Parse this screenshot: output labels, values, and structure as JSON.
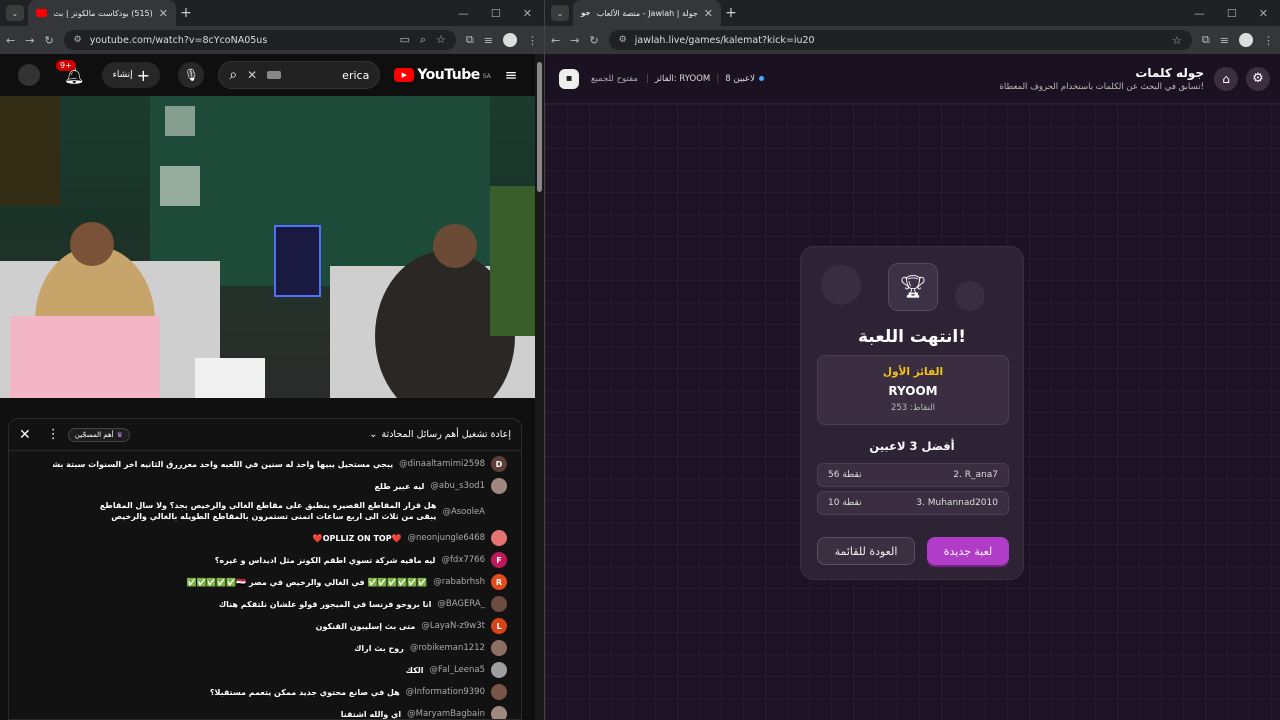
{
  "left": {
    "tab": {
      "title": "(515) بودكاست مالكونز | بث",
      "badge_color": "#ff0000"
    },
    "address": "youtube.com/watch?v=8cYcoNA05us",
    "youtube": {
      "logo": "YouTube",
      "region": "SA",
      "search_value": "erica",
      "create_label": "إنشاء",
      "notif_count": "9+",
      "brand_color": "#ff0000"
    },
    "chat": {
      "title": "إعادة تشغيل أهم رسائل المحادثة",
      "filter_badge": "أهم المسجّين",
      "messages": [
        {
          "name": "@dinaaltamimi2598",
          "text": "يبجي مستحيل يبيها واحد له سنين في اللعبه واحد معرررق الثانيه اخر السنوات سبتة بشكل مو طبيعي راح اللعب الحلو",
          "av": "D",
          "color": "#5d4037"
        },
        {
          "name": "@abu_s3od1",
          "text": "ليه عبير طلع",
          "av": "",
          "color": "#a1887f"
        },
        {
          "name": "@AsooleA",
          "text": "هل قرار المقاطع القصيره ينطبق على مقاطع الغالي والرخيص بحد؟ ولا سال المقاطع يبقى من ثلاث الى اربع ساعات اتمنى تستمرون بالمقاطع الطويله بالغالي والرخيص حالاقل لانها ممتعه جدا وتنحلنا جو",
          "av": "",
          "color": "#111111"
        },
        {
          "name": "@neonjungle6468",
          "text": "❤️OPLLIZ ON TOP❤️",
          "av": "",
          "color": "#e57373"
        },
        {
          "name": "@fdx7766",
          "text": "ليه مافيه شركة تسوي اطقم الكونز مثل اديداس و غيره؟",
          "av": "F",
          "color": "#c2185b"
        },
        {
          "name": "@rababrhsh",
          "text": "✅✅✅✅✅✅ في الغالي والرخيص في مصر 🇪🇬✅✅✅✅✅",
          "av": "R",
          "color": "#e64a19"
        },
        {
          "name": "@BAGERA_",
          "text": "انا بروحو فرنسا في الميجور قولو علشان نلتقكم هناك",
          "av": "",
          "color": "#6d4c41"
        },
        {
          "name": "@LayaN-z9w3t",
          "text": "متى بث إسليبون القنكون",
          "av": "L",
          "color": "#d84315"
        },
        {
          "name": "@robikeman1212",
          "text": "روح بث اراك",
          "av": "",
          "color": "#8d6e63"
        },
        {
          "name": "@Fal_Leena5",
          "text": "الكك",
          "av": "",
          "color": "#9e9e9e"
        },
        {
          "name": "@Information9390",
          "text": "هل في صانع محتوي جديد ممكن يتعمم مستقبلا؟",
          "av": "",
          "color": "#795548"
        },
        {
          "name": "@MaryamBagbain",
          "text": "اي والله اشتقنا",
          "av": "",
          "color": "#a1887f"
        }
      ]
    }
  },
  "right": {
    "tab": {
      "title": "جولة | Jawlah - منصة الألعاب الت..."
    },
    "address": "jawlah.live/games/kalemat?kick=iu20",
    "header": {
      "title": "جوله كلمات",
      "subtitle": "تسابق في البحث عن الكلمات باستخدام الحروف المعطاة!",
      "players": "8 لاعبين",
      "winner_label": "الفائز: RYOOM",
      "open_label": "مفتوح للجميع"
    },
    "result": {
      "title": "انتهت اللعبة!",
      "first_label": "الفائز الأول",
      "first_name": "RYOOM",
      "first_points": "النقاط: 253",
      "top_title": "أفضل 3 لاعبين",
      "rows": [
        {
          "name": "2. R_ana7",
          "points": "56 نقطة"
        },
        {
          "name": "3. Muhannad2010",
          "points": "10 نقطة"
        }
      ],
      "new_game": "لعبة جديدة",
      "back": "العودة للقائمة"
    },
    "accent": "#b03cc8",
    "gold": "#f5c518"
  }
}
